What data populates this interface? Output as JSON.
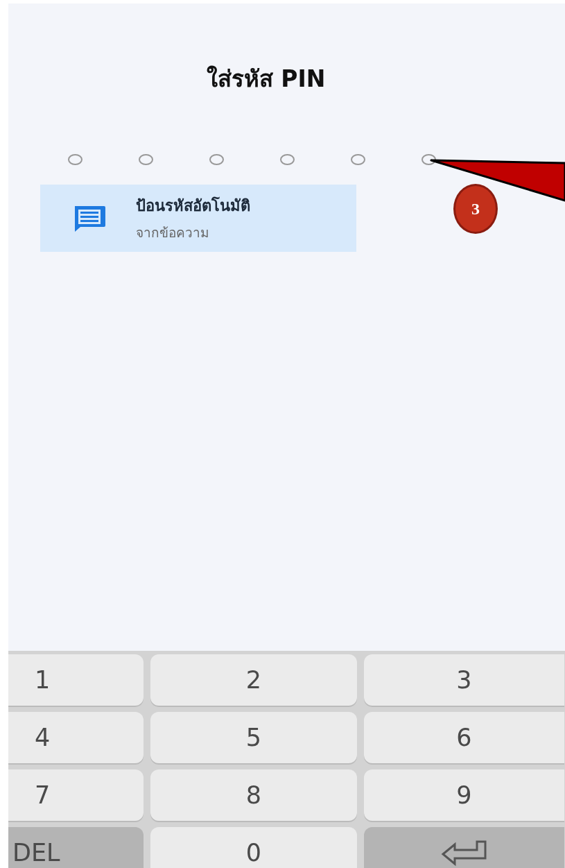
{
  "title": "ใส่รหัส PIN",
  "pin_dots": [
    {
      "filled": false
    },
    {
      "filled": false
    },
    {
      "filled": false
    },
    {
      "filled": false
    },
    {
      "filled": false
    },
    {
      "filled": false
    }
  ],
  "autofill": {
    "title": "ป้อนรหัสอัตโนมัติ",
    "subtitle": "จากข้อความ"
  },
  "annotation": {
    "number": "3"
  },
  "keypad": [
    {
      "kind": "digit",
      "label": "1"
    },
    {
      "kind": "digit",
      "label": "2"
    },
    {
      "kind": "digit",
      "label": "3"
    },
    {
      "kind": "digit",
      "label": "4"
    },
    {
      "kind": "digit",
      "label": "5"
    },
    {
      "kind": "digit",
      "label": "6"
    },
    {
      "kind": "digit",
      "label": "7"
    },
    {
      "kind": "digit",
      "label": "8"
    },
    {
      "kind": "digit",
      "label": "9"
    },
    {
      "kind": "del",
      "label": "DEL"
    },
    {
      "kind": "digit",
      "label": "0"
    },
    {
      "kind": "enter"
    }
  ]
}
